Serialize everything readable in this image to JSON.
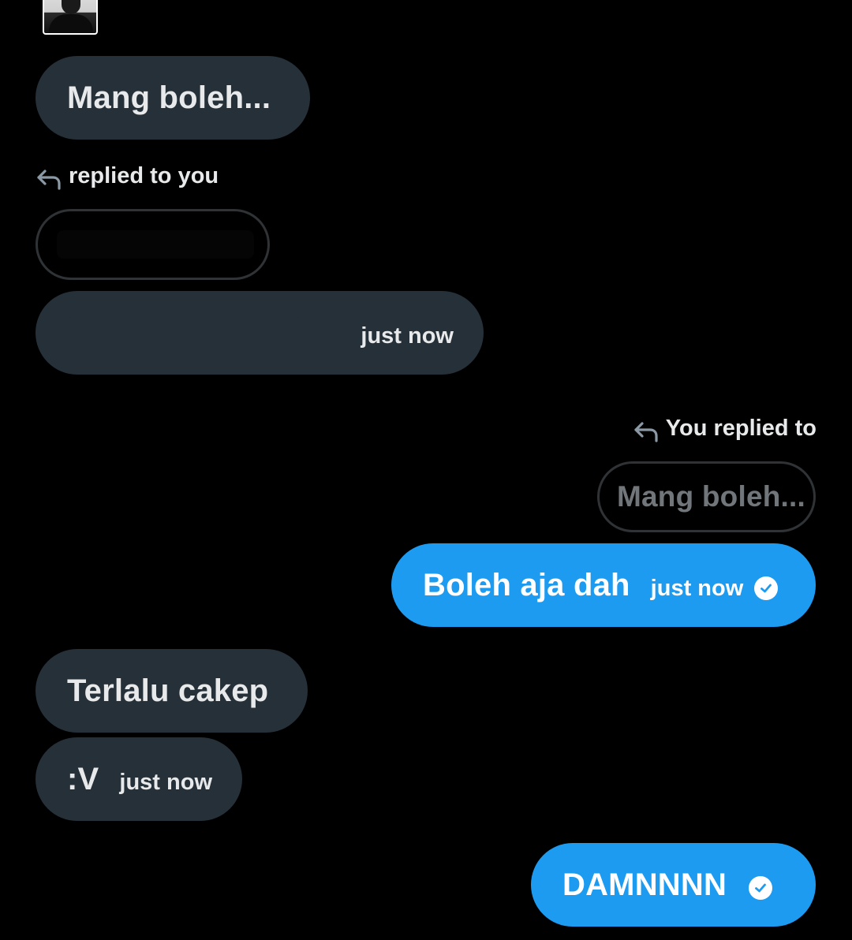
{
  "messages": {
    "m1": {
      "text": "Mang boleh..."
    },
    "reply_in": {
      "label": "replied to you"
    },
    "m2": {
      "time": "just now"
    },
    "reply_out": {
      "label": "You replied to",
      "quote": "Mang boleh..."
    },
    "m3": {
      "text": "Boleh aja dah",
      "time": "just now",
      "status": "check-circle-icon"
    },
    "m4": {
      "text": "Terlalu cakep"
    },
    "m5": {
      "text": ":V",
      "time": "just now"
    },
    "m6": {
      "text": "DAMNNNN",
      "status": "check-circle-icon"
    }
  },
  "colors": {
    "background": "#000000",
    "incoming_bubble": "#253038",
    "outgoing_bubble": "#1d9bf0",
    "text": "#e7e9ea",
    "muted": "#71767b"
  }
}
